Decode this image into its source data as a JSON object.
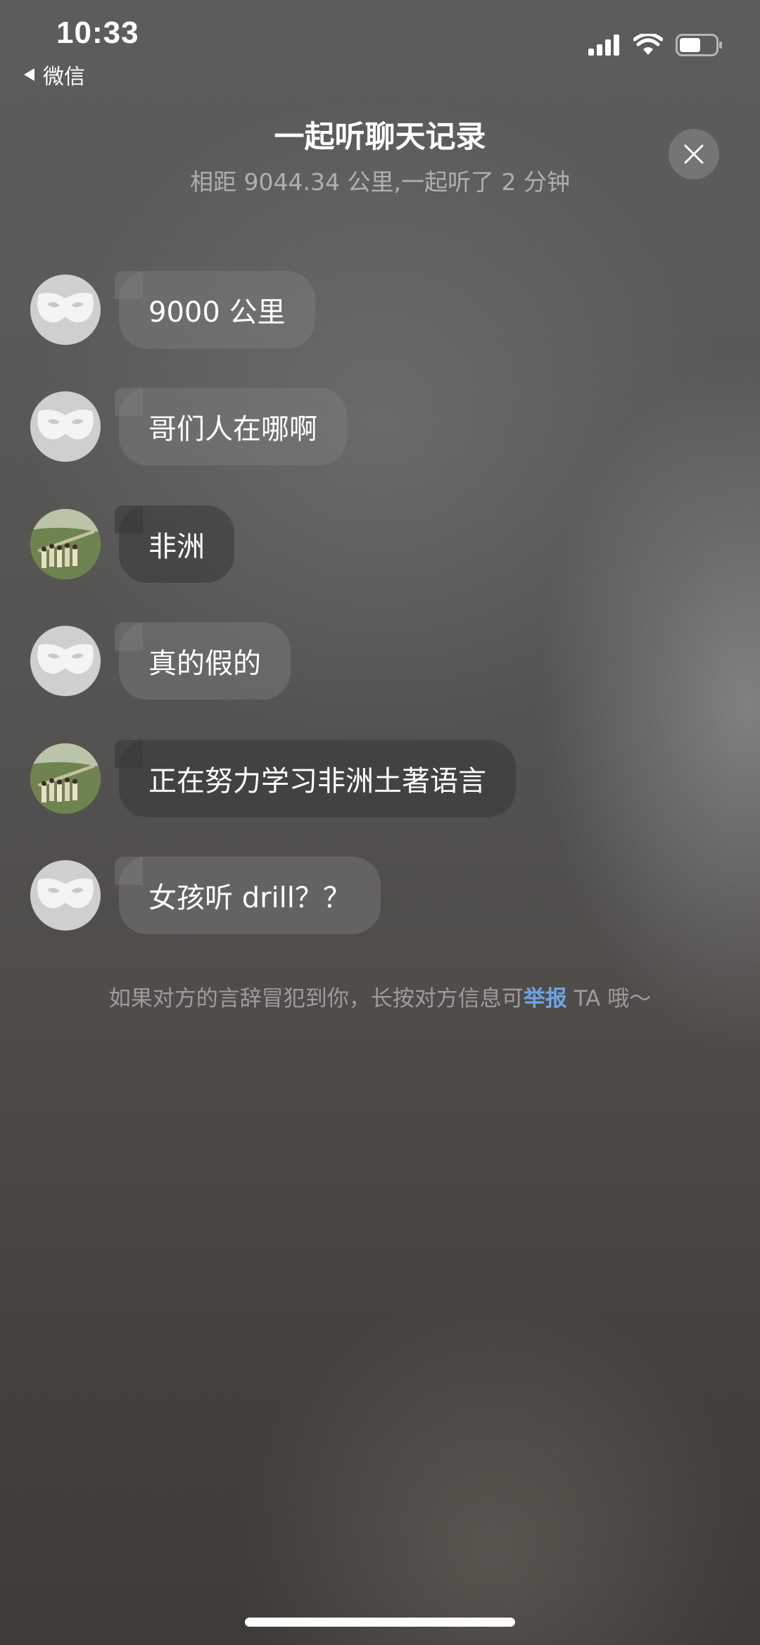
{
  "status_bar": {
    "time": "10:33",
    "back_app": "微信",
    "icons": [
      "cellular-signal-icon",
      "wifi-icon",
      "battery-icon"
    ],
    "battery_level": 0.55
  },
  "header": {
    "title": "一起听聊天记录",
    "subtitle": "相距 9044.34 公里,一起听了 2 分钟",
    "close_icon": "close-icon"
  },
  "messages": [
    {
      "sender": "other",
      "avatar": "mask-avatar",
      "text": "9000 公里"
    },
    {
      "sender": "other",
      "avatar": "mask-avatar",
      "text": "哥们人在哪啊"
    },
    {
      "sender": "self",
      "avatar": "photo-avatar",
      "text": "非洲"
    },
    {
      "sender": "other",
      "avatar": "mask-avatar",
      "text": "真的假的"
    },
    {
      "sender": "self",
      "avatar": "photo-avatar",
      "text": "正在努力学习非洲土著语言"
    },
    {
      "sender": "other",
      "avatar": "mask-avatar",
      "text": "女孩听 drill？？"
    }
  ],
  "notice": {
    "before": "如果对方的言辞冒犯到你，长按对方信息可",
    "link": "举报",
    "after": " TA 哦～"
  },
  "colors": {
    "link": "#6fa3e6",
    "bubble_other": "#6b6b6b",
    "bubble_self": "#3a3a3a"
  }
}
